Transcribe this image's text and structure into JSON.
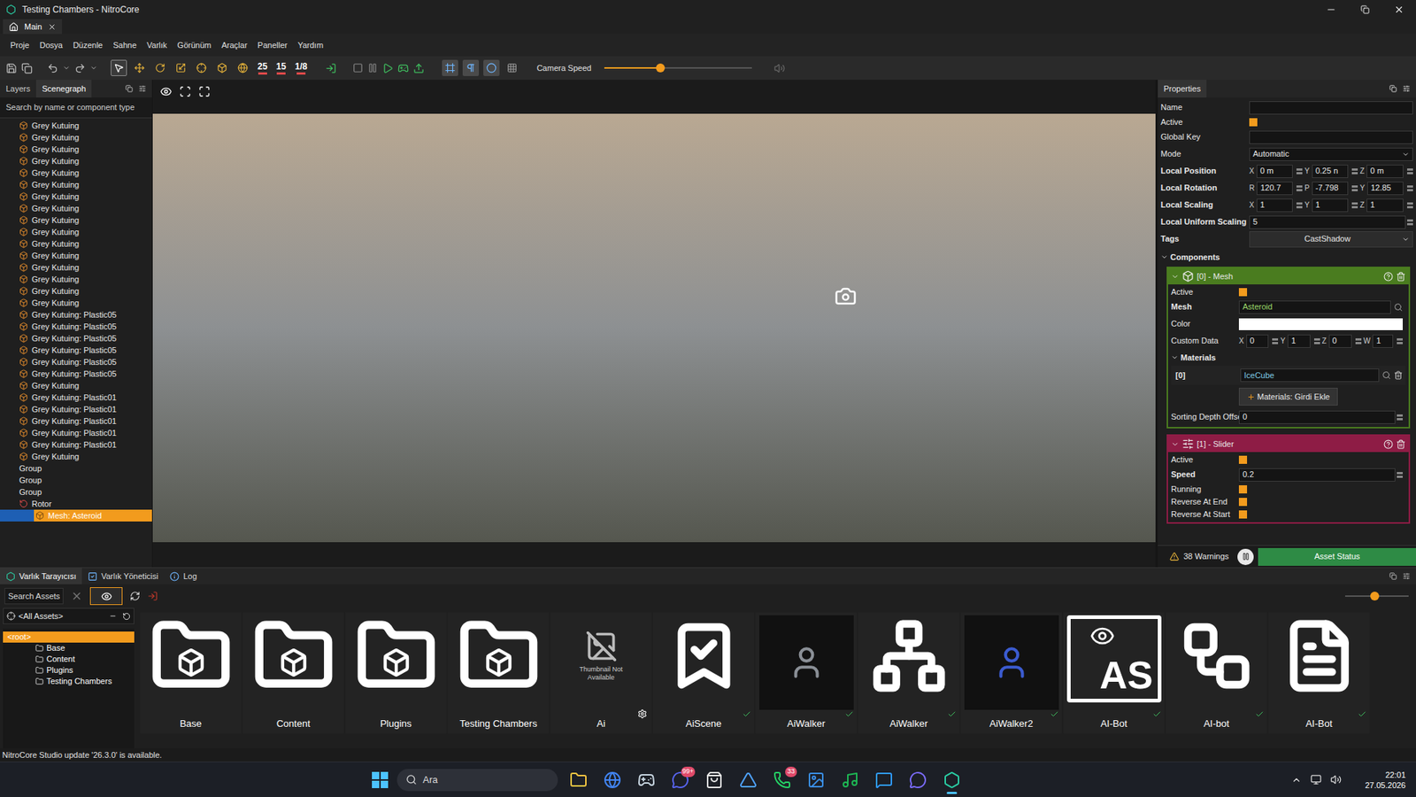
{
  "window": {
    "title": "Testing Chambers - NitroCore"
  },
  "doc_tabs": [
    {
      "label": "Main",
      "selected": true
    }
  ],
  "menu": [
    "Proje",
    "Dosya",
    "Düzenle",
    "Sahne",
    "Varlık",
    "Görünüm",
    "Araçlar",
    "Paneller",
    "Yardım"
  ],
  "toolbar": {
    "tools": [
      {
        "kind": "select",
        "selected": true
      },
      {
        "kind": "move",
        "selected": false
      },
      {
        "kind": "rotate",
        "selected": false
      },
      {
        "kind": "scale",
        "selected": false
      },
      {
        "kind": "pivot",
        "selected": false
      },
      {
        "kind": "box",
        "selected": false
      },
      {
        "kind": "globe",
        "selected": false
      }
    ],
    "counters": [
      {
        "value": "25"
      },
      {
        "value": "15"
      },
      {
        "value": "1/8"
      }
    ],
    "toggles": [
      {
        "kind": "region",
        "on": true
      },
      {
        "kind": "pilcrow",
        "on": true
      },
      {
        "kind": "dot",
        "on": true
      },
      {
        "kind": "grid",
        "on": false
      }
    ],
    "camera_speed": {
      "label": "Camera Speed",
      "level": 0.38
    }
  },
  "left_panel": {
    "tabs": [
      {
        "label": "Layers",
        "selected": false
      },
      {
        "label": "Scenegraph",
        "selected": true
      }
    ],
    "search_placeholder": "Search by name or component type",
    "tree": [
      {
        "label": "Grey Kutuing",
        "depth": 1,
        "kind": "object",
        "selected": false
      },
      {
        "label": "Grey Kutuing",
        "depth": 1,
        "kind": "object",
        "selected": false
      },
      {
        "label": "Grey Kutuing",
        "depth": 1,
        "kind": "object",
        "selected": false
      },
      {
        "label": "Grey Kutuing",
        "depth": 1,
        "kind": "object",
        "selected": false
      },
      {
        "label": "Grey Kutuing",
        "depth": 1,
        "kind": "object",
        "selected": false
      },
      {
        "label": "Grey Kutuing",
        "depth": 1,
        "kind": "object",
        "selected": false
      },
      {
        "label": "Grey Kutuing",
        "depth": 1,
        "kind": "object",
        "selected": false
      },
      {
        "label": "Grey Kutuing",
        "depth": 1,
        "kind": "object",
        "selected": false
      },
      {
        "label": "Grey Kutuing",
        "depth": 1,
        "kind": "object",
        "selected": false
      },
      {
        "label": "Grey Kutuing",
        "depth": 1,
        "kind": "object",
        "selected": false
      },
      {
        "label": "Grey Kutuing",
        "depth": 1,
        "kind": "object",
        "selected": false
      },
      {
        "label": "Grey Kutuing",
        "depth": 1,
        "kind": "object",
        "selected": false
      },
      {
        "label": "Grey Kutuing",
        "depth": 1,
        "kind": "object",
        "selected": false
      },
      {
        "label": "Grey Kutuing",
        "depth": 1,
        "kind": "object",
        "selected": false
      },
      {
        "label": "Grey Kutuing",
        "depth": 1,
        "kind": "object",
        "selected": false
      },
      {
        "label": "Grey Kutuing",
        "depth": 1,
        "kind": "object",
        "selected": false
      },
      {
        "label": "Grey Kutuing: Plastic05",
        "depth": 1,
        "kind": "object",
        "selected": false
      },
      {
        "label": "Grey Kutuing: Plastic05",
        "depth": 1,
        "kind": "object",
        "selected": false
      },
      {
        "label": "Grey Kutuing: Plastic05",
        "depth": 1,
        "kind": "object",
        "selected": false
      },
      {
        "label": "Grey Kutuing: Plastic05",
        "depth": 1,
        "kind": "object",
        "selected": false
      },
      {
        "label": "Grey Kutuing: Plastic05",
        "depth": 1,
        "kind": "object",
        "selected": false
      },
      {
        "label": "Grey Kutuing: Plastic05",
        "depth": 1,
        "kind": "object",
        "selected": false
      },
      {
        "label": "Grey Kutuing",
        "depth": 1,
        "kind": "object",
        "selected": false
      },
      {
        "label": "Grey Kutuing: Plastic01",
        "depth": 1,
        "kind": "object",
        "selected": false
      },
      {
        "label": "Grey Kutuing: Plastic01",
        "depth": 1,
        "kind": "object",
        "selected": false
      },
      {
        "label": "Grey Kutuing: Plastic01",
        "depth": 1,
        "kind": "object",
        "selected": false
      },
      {
        "label": "Grey Kutuing: Plastic01",
        "depth": 1,
        "kind": "object",
        "selected": false
      },
      {
        "label": "Grey Kutuing: Plastic01",
        "depth": 1,
        "kind": "object",
        "selected": false
      },
      {
        "label": "Grey Kutuing",
        "depth": 1,
        "kind": "object",
        "selected": false
      },
      {
        "label": "Group",
        "depth": 1,
        "kind": "group",
        "selected": false
      },
      {
        "label": "Group",
        "depth": 1,
        "kind": "group",
        "selected": false
      },
      {
        "label": "Group",
        "depth": 1,
        "kind": "group",
        "selected": false
      },
      {
        "label": "Rotor",
        "depth": 1,
        "kind": "rotor",
        "selected": false
      },
      {
        "label": "Mesh: Asteroid",
        "depth": 2,
        "kind": "mesh",
        "selected": true
      }
    ]
  },
  "properties": {
    "title": "Properties",
    "rows": [
      {
        "kind": "text",
        "label": "Name",
        "value": "",
        "bold": false
      },
      {
        "kind": "check",
        "label": "Active",
        "checked": true,
        "bold": false
      },
      {
        "kind": "text",
        "label": "Global Key",
        "value": "",
        "bold": false
      },
      {
        "kind": "select",
        "label": "Mode",
        "value": "Automatic",
        "bold": false
      },
      {
        "kind": "vector",
        "label": "Local Position",
        "bold": true,
        "fields": [
          {
            "axis": "X",
            "value": "0 m"
          },
          {
            "axis": "Y",
            "value": "0.25 n"
          },
          {
            "axis": "Z",
            "value": "0 m"
          }
        ]
      },
      {
        "kind": "vector",
        "label": "Local Rotation",
        "bold": true,
        "fields": [
          {
            "axis": "R",
            "value": "120.7"
          },
          {
            "axis": "P",
            "value": "-7.798"
          },
          {
            "axis": "Y",
            "value": "12.85"
          }
        ]
      },
      {
        "kind": "vector",
        "label": "Local Scaling",
        "bold": true,
        "fields": [
          {
            "axis": "X",
            "value": "1"
          },
          {
            "axis": "Y",
            "value": "1"
          },
          {
            "axis": "Z",
            "value": "1"
          }
        ]
      },
      {
        "kind": "number",
        "label": "Local Uniform Scaling",
        "value": "5",
        "bold": true
      },
      {
        "kind": "tags",
        "label": "Tags",
        "value": "CastShadow",
        "bold": true
      }
    ],
    "components_label": "Components",
    "components": [
      {
        "title": "[0] - Mesh",
        "color": "#4a7c1f",
        "kind": "mesh",
        "expanded": true,
        "rows": [
          {
            "kind": "check",
            "label": "Active",
            "checked": true,
            "bold": false
          },
          {
            "kind": "asset",
            "label": "Mesh",
            "value": "Asteroid",
            "color": "#9bd86a",
            "bold": true
          },
          {
            "kind": "color",
            "label": "Color",
            "color": "#ffffff",
            "bold": false
          },
          {
            "kind": "vector4",
            "label": "Custom Data",
            "bold": false,
            "fields": [
              {
                "axis": "X",
                "value": "0"
              },
              {
                "axis": "Y",
                "value": "1"
              },
              {
                "axis": "Z",
                "value": "0"
              },
              {
                "axis": "W",
                "value": "1"
              }
            ]
          },
          {
            "kind": "materials",
            "label": "Materials",
            "expanded": true,
            "items": [
              {
                "index": "[0]",
                "value": "IceCube"
              }
            ],
            "add": "Materials: Girdi Ekle"
          },
          {
            "kind": "number",
            "label": "Sorting Depth Offse",
            "value": "0",
            "bold": false
          }
        ]
      },
      {
        "title": "[1] - Slider",
        "color": "#8e1c45",
        "kind": "slider",
        "expanded": true,
        "rows": [
          {
            "kind": "check",
            "label": "Active",
            "checked": true,
            "bold": false
          },
          {
            "kind": "number",
            "label": "Speed",
            "value": "0.2",
            "bold": true
          },
          {
            "kind": "check",
            "label": "Running",
            "checked": true,
            "bold": false
          },
          {
            "kind": "check",
            "label": "Reverse At End",
            "checked": true,
            "bold": false
          },
          {
            "kind": "check",
            "label": "Reverse At Start",
            "checked": true,
            "bold": false
          }
        ]
      }
    ],
    "warnings": "38 Warnings",
    "asset_status": "Asset Status"
  },
  "bottom_panel": {
    "tabs": [
      {
        "label": "Varlık Tarayıcısı",
        "selected": true,
        "kind": "browser"
      },
      {
        "label": "Varlık Yöneticisi",
        "selected": false,
        "kind": "manager"
      },
      {
        "label": "Log",
        "selected": false,
        "kind": "log"
      }
    ],
    "search_placeholder": "Search Assets",
    "show_items": true,
    "zoom_level": 0.46,
    "filter": "<All Assets>",
    "tree": [
      {
        "label": "<root>",
        "depth": 0,
        "selected": true
      },
      {
        "label": "Base",
        "depth": 1,
        "selected": false
      },
      {
        "label": "Content",
        "depth": 1,
        "selected": false
      },
      {
        "label": "Plugins",
        "depth": 1,
        "selected": false
      },
      {
        "label": "Testing Chambers",
        "depth": 1,
        "selected": false
      }
    ],
    "assets": [
      {
        "label": "Base",
        "kind": "folder",
        "ok": false
      },
      {
        "label": "Content",
        "kind": "folder",
        "ok": false
      },
      {
        "label": "Plugins",
        "kind": "folder",
        "ok": false
      },
      {
        "label": "Testing Chambers",
        "kind": "folder",
        "ok": false
      },
      {
        "label": "Ai",
        "kind": "no-thumb",
        "thumb_text": "Thumbnail Not Available",
        "ok": false
      },
      {
        "label": "AiScene",
        "kind": "scene",
        "ok": true
      },
      {
        "label": "AiWalker",
        "kind": "preview",
        "color": "#8a8f96",
        "ok": true
      },
      {
        "label": "AiWalker",
        "kind": "tree",
        "ok": true
      },
      {
        "label": "AiWalker2",
        "kind": "preview",
        "color": "#3b5bd0",
        "ok": true
      },
      {
        "label": "AI-Bot",
        "kind": "script",
        "thumb_text": "AS",
        "ok": true
      },
      {
        "label": "AI-bot",
        "kind": "network",
        "ok": true
      },
      {
        "label": "AI-Bot",
        "kind": "document",
        "ok": true
      }
    ]
  },
  "status_bar": "NitroCore Studio update '26.3.0' is available.",
  "taskbar": {
    "search": "Ara",
    "time": "22:01",
    "date": "27.05.2026",
    "apps": [
      {
        "kind": "explorer",
        "color": "#f5c542",
        "active": false,
        "badge": ""
      },
      {
        "kind": "chrome",
        "color": "#4285f4",
        "active": false,
        "badge": ""
      },
      {
        "kind": "steam",
        "color": "#c7d5e0",
        "active": false,
        "badge": ""
      },
      {
        "kind": "discord",
        "color": "#5865f2",
        "active": false,
        "badge": "99+"
      },
      {
        "kind": "store",
        "color": "#e8e8e8",
        "active": false,
        "badge": ""
      },
      {
        "kind": "affinity",
        "color": "#4fa3ff",
        "active": false,
        "badge": ""
      },
      {
        "kind": "whatsapp",
        "color": "#25d366",
        "active": false,
        "badge": "33"
      },
      {
        "kind": "photos",
        "color": "#3a8ee6",
        "active": false,
        "badge": ""
      },
      {
        "kind": "spotify",
        "color": "#1db954",
        "active": false,
        "badge": ""
      },
      {
        "kind": "messages",
        "color": "#2f9bff",
        "active": false,
        "badge": ""
      },
      {
        "kind": "chat",
        "color": "#7b6cff",
        "active": false,
        "badge": ""
      },
      {
        "kind": "nitrocore",
        "color": "#2ad0a6",
        "active": true,
        "badge": ""
      }
    ]
  }
}
